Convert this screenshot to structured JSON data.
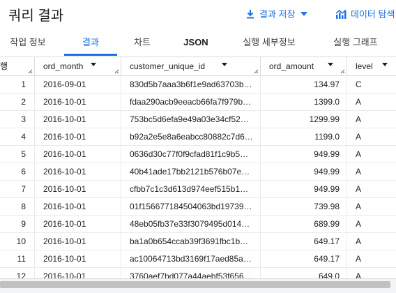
{
  "header": {
    "title": "쿼리 결과",
    "save_label": "결과 저장",
    "explore_label": "데이터 탐색"
  },
  "tabs": [
    {
      "label": "작업 정보"
    },
    {
      "label": "결과"
    },
    {
      "label": "차트"
    },
    {
      "label": "JSON"
    },
    {
      "label": "실행 세부정보"
    },
    {
      "label": "실행 그래프"
    }
  ],
  "table": {
    "columns": [
      "행",
      "ord_month",
      "customer_unique_id",
      "ord_amount",
      "level"
    ],
    "rows": [
      [
        "1",
        "2016-09-01",
        "830d5b7aaa3b6f1e9ad63703b…",
        "134.97",
        "C"
      ],
      [
        "2",
        "2016-10-01",
        "fdaa290acb9eeacb66fa7f979b…",
        "1399.0",
        "A"
      ],
      [
        "3",
        "2016-10-01",
        "753bc5d6efa9e49a03e34cf52…",
        "1299.99",
        "A"
      ],
      [
        "4",
        "2016-10-01",
        "b92a2e5e8a6eabcc80882c7d6…",
        "1199.0",
        "A"
      ],
      [
        "5",
        "2016-10-01",
        "0636d30c77f0f9cfad81f1c9b5…",
        "949.99",
        "A"
      ],
      [
        "6",
        "2016-10-01",
        "40b41ade17bb2121b576b07e…",
        "949.99",
        "A"
      ],
      [
        "7",
        "2016-10-01",
        "cfbb7c1c3d613d974eef515b1…",
        "949.99",
        "A"
      ],
      [
        "8",
        "2016-10-01",
        "01f156677184504063bd19739…",
        "739.98",
        "A"
      ],
      [
        "9",
        "2016-10-01",
        "48eb05fb37e33f3079495d014…",
        "689.99",
        "A"
      ],
      [
        "10",
        "2016-10-01",
        "ba1a0b654ccab39f3691fbc1b…",
        "649.17",
        "A"
      ],
      [
        "11",
        "2016-10-01",
        "ac10064713bd3169f17aed85a…",
        "649.17",
        "A"
      ],
      [
        "12",
        "2016-10-01",
        "3760aef7bd077a44aebf53f656…",
        "649.0",
        "A"
      ]
    ]
  },
  "colors": {
    "accent": "#1a73e8",
    "text": "#202124",
    "border": "#dadce0"
  }
}
